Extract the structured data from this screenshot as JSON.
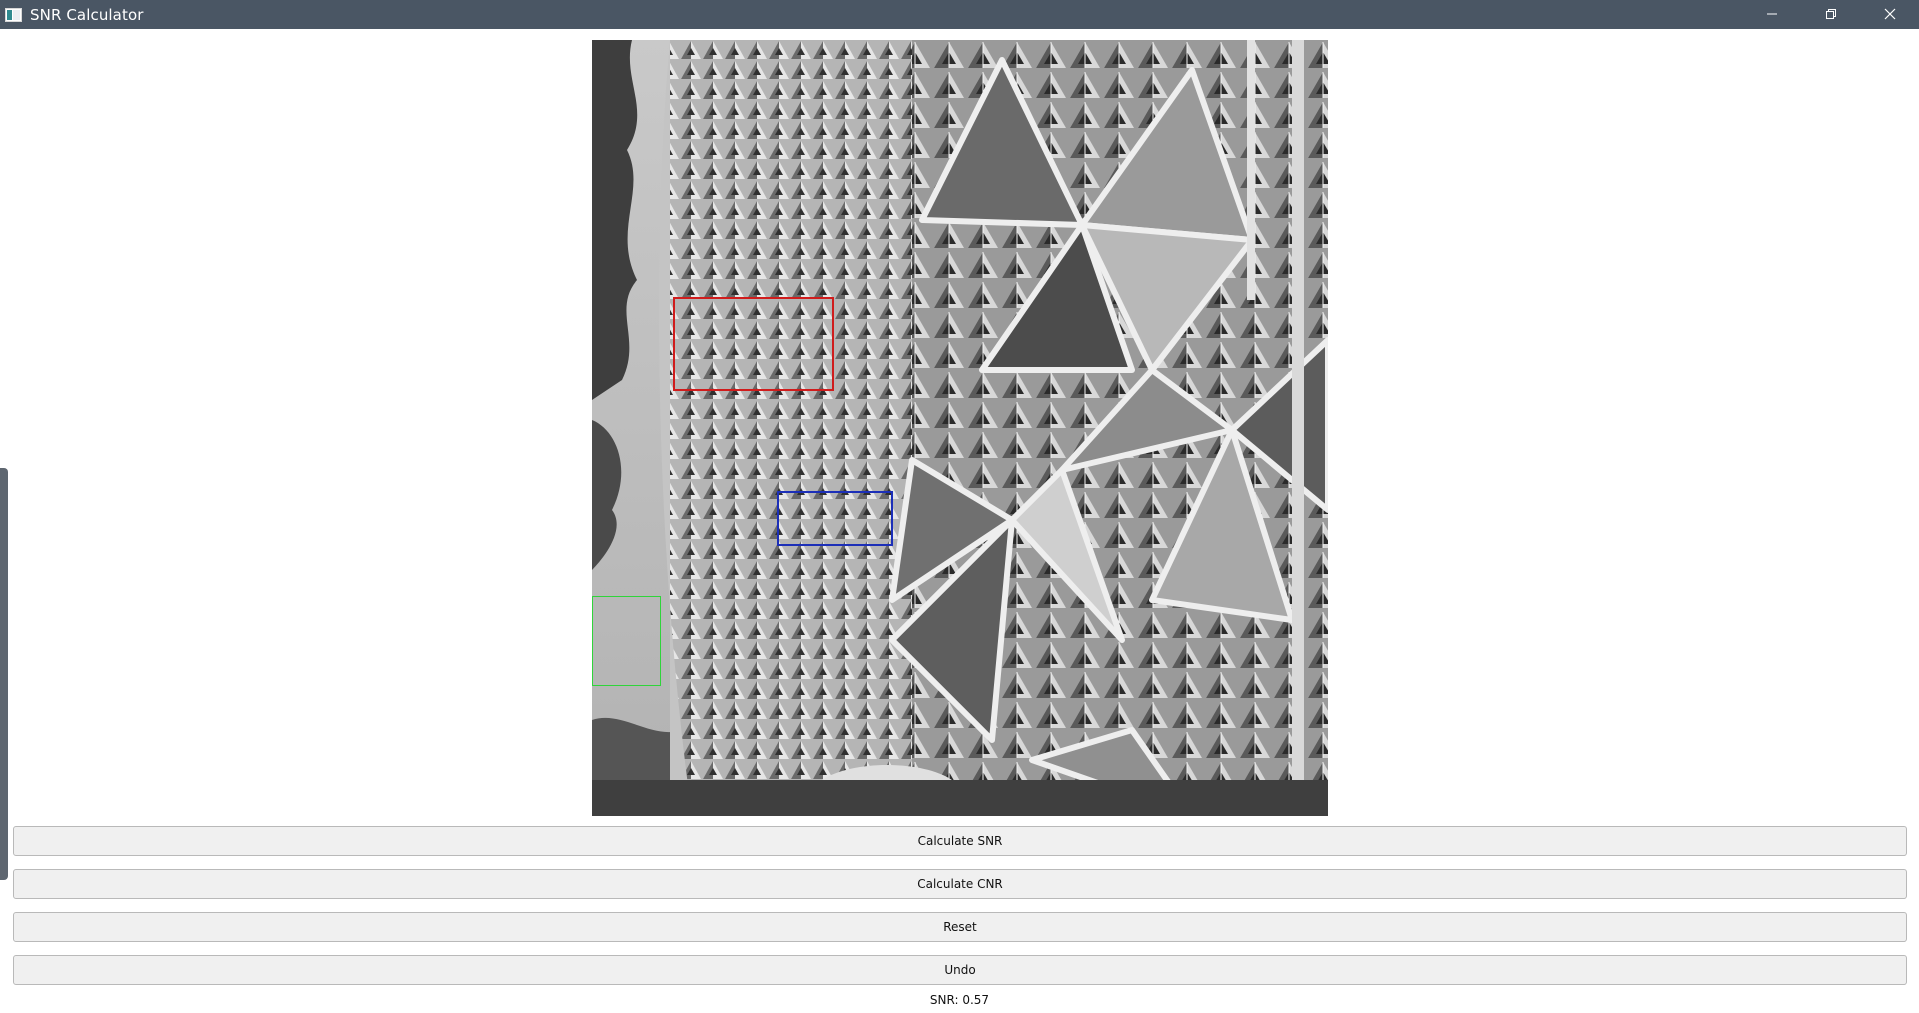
{
  "window": {
    "title": "SNR Calculator",
    "icon": "app-window-icon",
    "controls": [
      "minimize-icon",
      "restore-icon",
      "close-icon"
    ]
  },
  "image_view": {
    "roi_colors": {
      "red": "#d01c1c",
      "blue": "#1c2fb8",
      "green": "#2fd43a"
    }
  },
  "buttons": {
    "calculate_snr": "Calculate SNR",
    "calculate_cnr": "Calculate CNR",
    "reset": "Reset",
    "undo": "Undo"
  },
  "result": {
    "text": "SNR: 0.57"
  },
  "colors": {
    "titlebar": "#4a5664",
    "button_bg": "#f0f0f0",
    "button_border": "#b9b9b9"
  }
}
